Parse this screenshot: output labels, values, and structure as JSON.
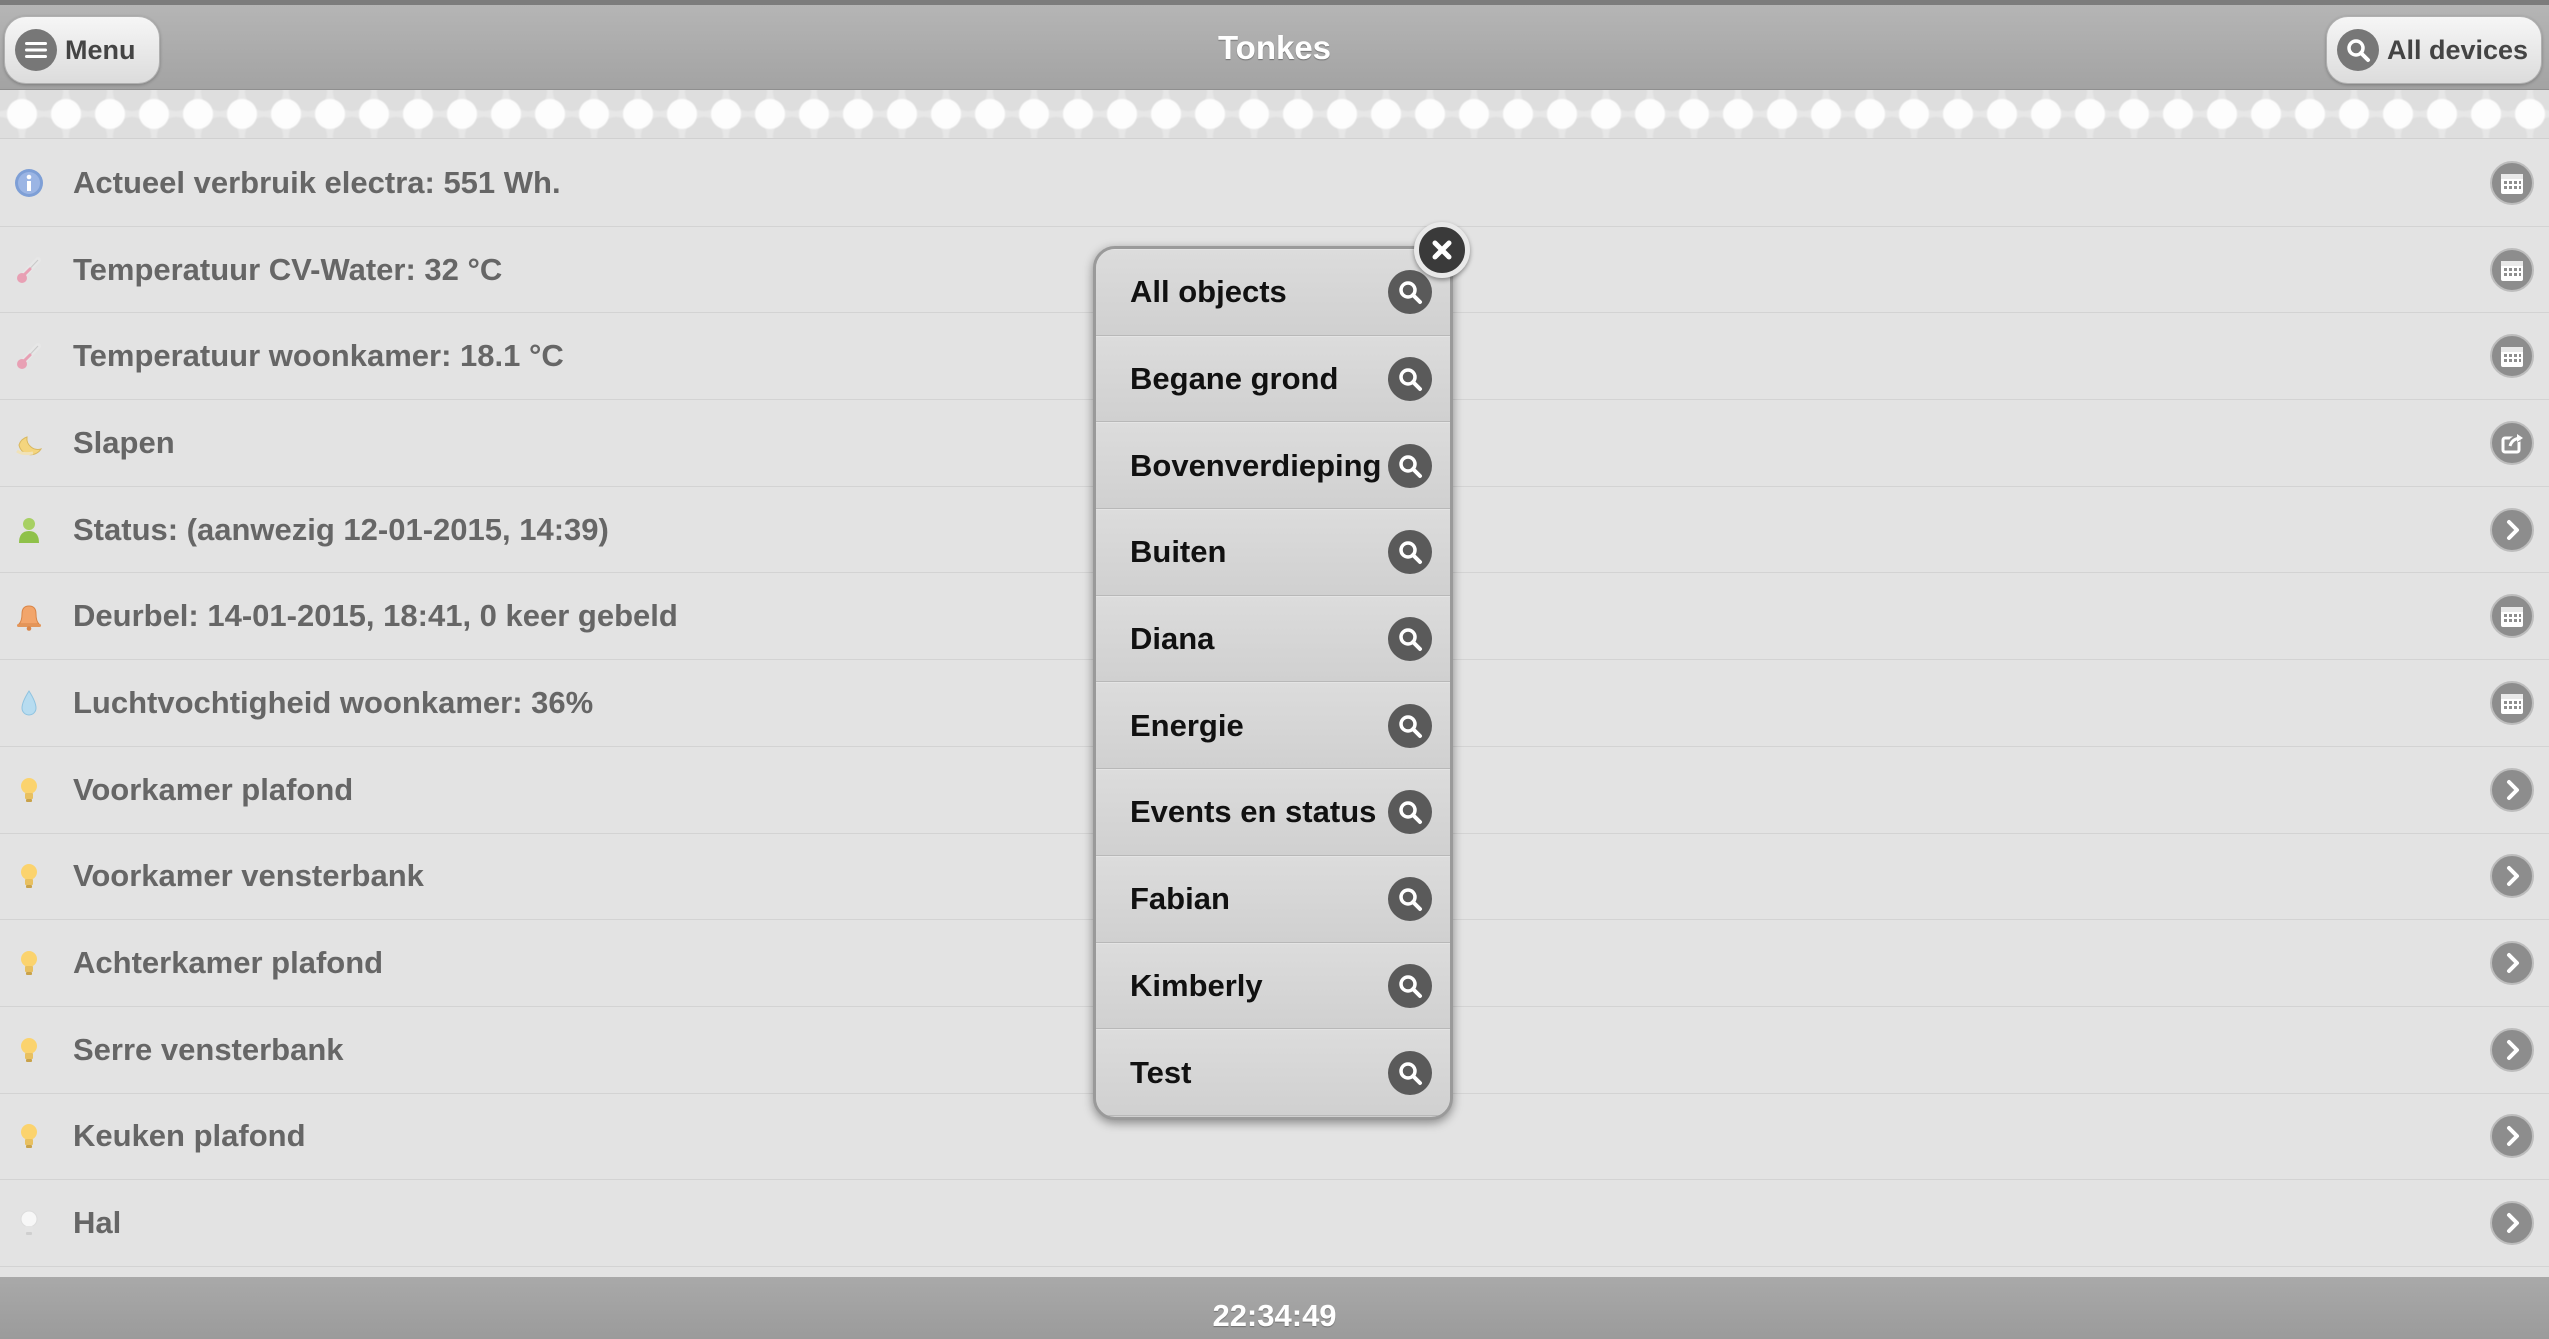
{
  "header": {
    "title": "Tonkes",
    "menu_label": "Menu",
    "devices_label": "All devices"
  },
  "rows": [
    {
      "icon": "info-icon",
      "label": "Actueel verbruik electra: 551 Wh.",
      "action": "calendar-icon"
    },
    {
      "icon": "thermometer-icon",
      "label": "Temperatuur CV-Water: 32 °C",
      "action": "calendar-icon"
    },
    {
      "icon": "thermometer-icon",
      "label": "Temperatuur woonkamer: 18.1 °C",
      "action": "calendar-icon"
    },
    {
      "icon": "moon-icon",
      "label": "Slapen",
      "action": "share-icon"
    },
    {
      "icon": "person-icon",
      "label": "Status: (aanwezig 12-01-2015, 14:39)",
      "action": "chevron-right-icon"
    },
    {
      "icon": "bell-icon",
      "label": "Deurbel: 14-01-2015, 18:41, 0 keer gebeld",
      "action": "calendar-icon"
    },
    {
      "icon": "droplet-icon",
      "label": "Luchtvochtigheid woonkamer: 36%",
      "action": "calendar-icon"
    },
    {
      "icon": "lightbulb-on-icon",
      "label": "Voorkamer plafond",
      "action": "chevron-right-icon"
    },
    {
      "icon": "lightbulb-on-icon",
      "label": "Voorkamer vensterbank",
      "action": "chevron-right-icon"
    },
    {
      "icon": "lightbulb-on-icon",
      "label": "Achterkamer plafond",
      "action": "chevron-right-icon"
    },
    {
      "icon": "lightbulb-on-icon",
      "label": "Serre vensterbank",
      "action": "chevron-right-icon"
    },
    {
      "icon": "lightbulb-on-icon",
      "label": "Keuken plafond",
      "action": "chevron-right-icon"
    },
    {
      "icon": "lightbulb-off-icon",
      "label": "Hal",
      "action": "chevron-right-icon"
    }
  ],
  "popup": {
    "items": [
      "All objects",
      "Begane grond",
      "Bovenverdieping",
      "Buiten",
      "Diana",
      "Energie",
      "Events en status",
      "Fabian",
      "Kimberly",
      "Test"
    ]
  },
  "footer": {
    "clock": "22:34:49"
  },
  "colors": {
    "header": "#a8a8a8",
    "list_bg": "#e3e3e3",
    "row_text": "#666666",
    "popup_bg": "#d0d0d0",
    "popup_text": "#111111",
    "action_button": "#8d8d8d"
  }
}
